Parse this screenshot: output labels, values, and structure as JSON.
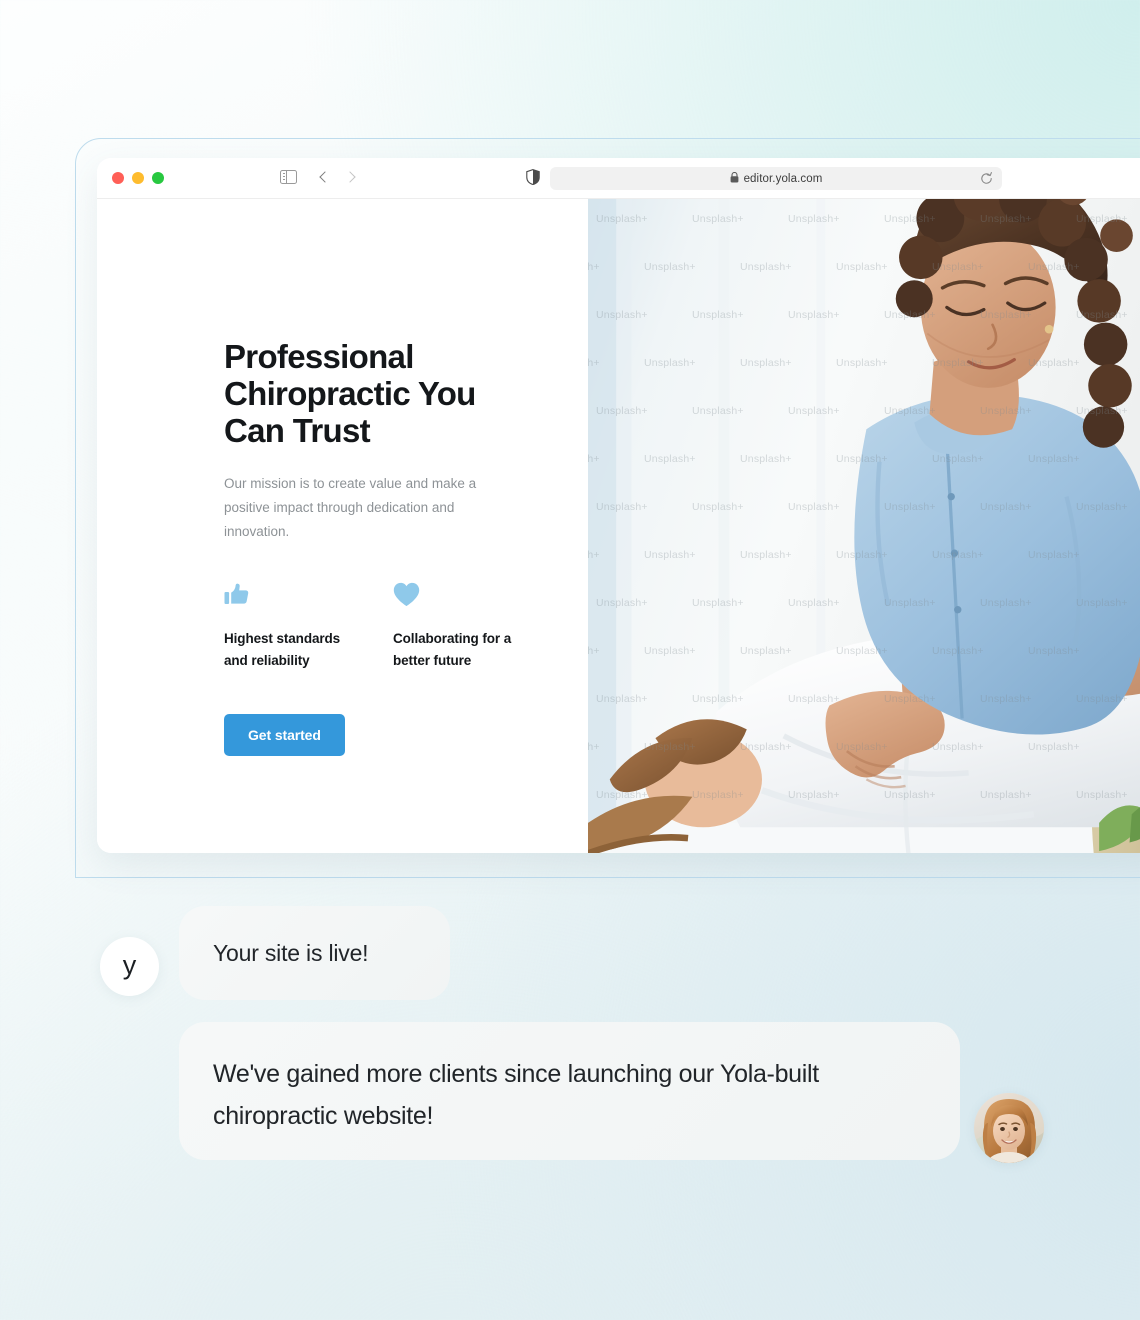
{
  "browser": {
    "traffic_lights": [
      "close",
      "minimize",
      "maximize"
    ],
    "sidebar_toggle_name": "sidebar-toggle-icon",
    "back_label": "Back",
    "forward_label": "Forward",
    "shield_label": "Privacy Report",
    "url": "editor.yola.com",
    "lock_glyph": "🔒",
    "reload_label": "Reload"
  },
  "site": {
    "hero": {
      "title": "Professional Chiropractic You Can Trust",
      "subtitle": "Our mission is to create value and make a positive impact through dedication and innovation.",
      "cta_label": "Get started",
      "features": [
        {
          "icon": "thumbs-up-icon",
          "label": "Highest standards and reliability"
        },
        {
          "icon": "heart-icon",
          "label": "Collaborating for a better future"
        }
      ],
      "image_alt": "Chiropractor adjusting a patient lying on a treatment table",
      "watermark_text": "Unsplash+"
    }
  },
  "chat": {
    "brand_initial": "y",
    "messages": [
      {
        "sender": "yola",
        "text": "Your site is live!"
      },
      {
        "sender": "client",
        "text": "We've gained more clients since launching our Yola-built chiropractic website!"
      }
    ],
    "client_avatar_alt": "Smiling woman with light brown hair"
  },
  "colors": {
    "accent_blue": "#3498db",
    "icon_blue": "#8fc9ea",
    "heading": "#14171a",
    "body_text": "#8d9296",
    "bubble_bg": "#f4f6f6",
    "frame_border": "#bedced"
  }
}
